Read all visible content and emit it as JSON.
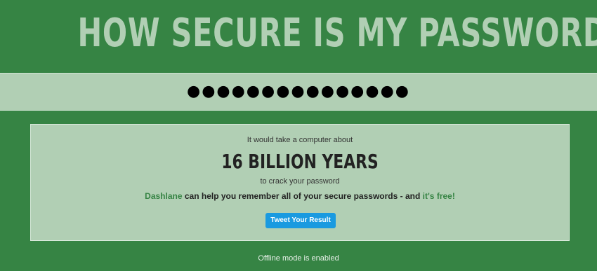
{
  "header": {
    "title": "HOW SECURE IS MY PASSWORD?"
  },
  "password": {
    "value": "●●●●●●●●●●●●●●●"
  },
  "result": {
    "intro": "It would take a computer about",
    "time": "16 BILLION YEARS",
    "outro": "to crack your password",
    "promo_brand": "Dashlane",
    "promo_text": " can help you remember all of your secure passwords - and ",
    "promo_free": "it's free!",
    "tweet_label": "Tweet Your Result"
  },
  "footer": {
    "status": "Offline mode is enabled"
  },
  "colors": {
    "background": "#368444",
    "panel": "#b1cfb4",
    "accent_green": "#368444",
    "tweet_button": "#1a9ae0"
  }
}
